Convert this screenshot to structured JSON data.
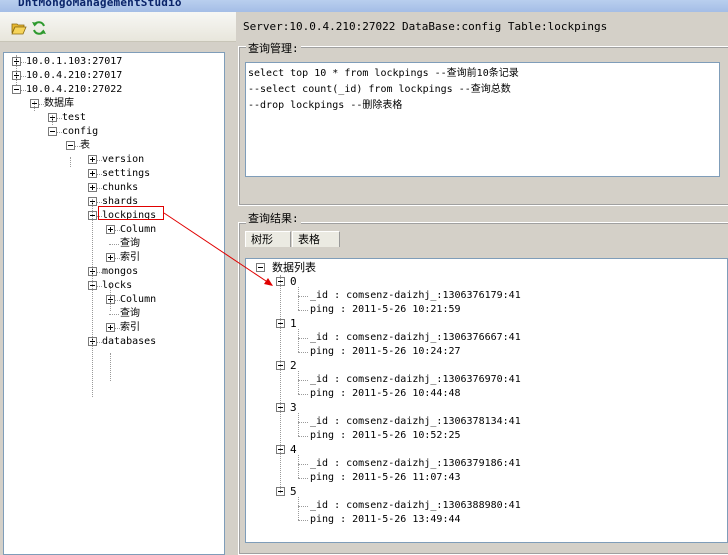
{
  "window": {
    "title": "DntMongoManagementStudio"
  },
  "toolbar": {
    "open_icon": "folder-open-icon",
    "refresh_icon": "refresh-icon"
  },
  "server_info": "Server:10.0.4.210:27022 DataBase:config Table:lockpings",
  "query_group": {
    "title": "查询管理:",
    "lines": [
      "select top 10 * from lockpings --查询前10条记录",
      "--select count(_id) from lockpings --查询总数",
      "--drop lockpings --删除表格"
    ]
  },
  "result_group": {
    "title": "查询结果:",
    "tabs": [
      "树形",
      "表格"
    ],
    "root": "数据列表",
    "records": [
      {
        "index": "0",
        "id": "_id : comsenz-daizhj_:1306376179:41",
        "ping": "ping : 2011-5-26 10:21:59"
      },
      {
        "index": "1",
        "id": "_id : comsenz-daizhj_:1306376667:41",
        "ping": "ping : 2011-5-26 10:24:27"
      },
      {
        "index": "2",
        "id": "_id : comsenz-daizhj_:1306376970:41",
        "ping": "ping : 2011-5-26 10:44:48"
      },
      {
        "index": "3",
        "id": "_id : comsenz-daizhj_:1306378134:41",
        "ping": "ping : 2011-5-26 10:52:25"
      },
      {
        "index": "4",
        "id": "_id : comsenz-daizhj_:1306379186:41",
        "ping": "ping : 2011-5-26 11:07:43"
      },
      {
        "index": "5",
        "id": "_id : comsenz-daizhj_:1306388980:41",
        "ping": "ping : 2011-5-26 13:49:44"
      }
    ]
  },
  "tree": {
    "servers": [
      "10.0.1.103:27017",
      "10.0.4.210:27017",
      "10.0.4.210:27022"
    ],
    "db_root": "数据库",
    "databases": [
      "test",
      "config"
    ],
    "tables_label": "表",
    "tables": [
      "version",
      "settings",
      "chunks",
      "shards",
      "lockpings",
      "mongos",
      "locks",
      "databases"
    ],
    "sub_items": [
      "Column",
      "查询",
      "索引"
    ]
  },
  "colors": {
    "highlight": "#e00000",
    "arrow": "#e00000",
    "panel_border": "#7f9db9"
  }
}
